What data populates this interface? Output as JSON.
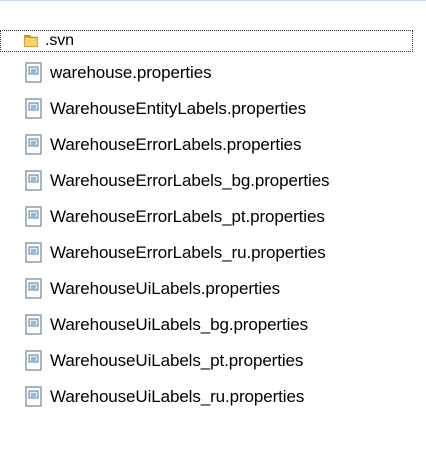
{
  "files": [
    {
      "name": ".svn",
      "icon": "folder-icon",
      "selected": true
    },
    {
      "name": "warehouse.properties",
      "icon": "document-icon",
      "selected": false
    },
    {
      "name": "WarehouseEntityLabels.properties",
      "icon": "document-icon",
      "selected": false
    },
    {
      "name": "WarehouseErrorLabels.properties",
      "icon": "document-icon",
      "selected": false
    },
    {
      "name": "WarehouseErrorLabels_bg.properties",
      "icon": "document-icon",
      "selected": false
    },
    {
      "name": "WarehouseErrorLabels_pt.properties",
      "icon": "document-icon",
      "selected": false
    },
    {
      "name": "WarehouseErrorLabels_ru.properties",
      "icon": "document-icon",
      "selected": false
    },
    {
      "name": "WarehouseUiLabels.properties",
      "icon": "document-icon",
      "selected": false
    },
    {
      "name": "WarehouseUiLabels_bg.properties",
      "icon": "document-icon",
      "selected": false
    },
    {
      "name": "WarehouseUiLabels_pt.properties",
      "icon": "document-icon",
      "selected": false
    },
    {
      "name": "WarehouseUiLabels_ru.properties",
      "icon": "document-icon",
      "selected": false
    }
  ],
  "colors": {
    "folder": "#d8a63a",
    "folder_highlight": "#f6d36b",
    "document_border": "#8b949e",
    "document_lines": "#4a7fb5"
  }
}
